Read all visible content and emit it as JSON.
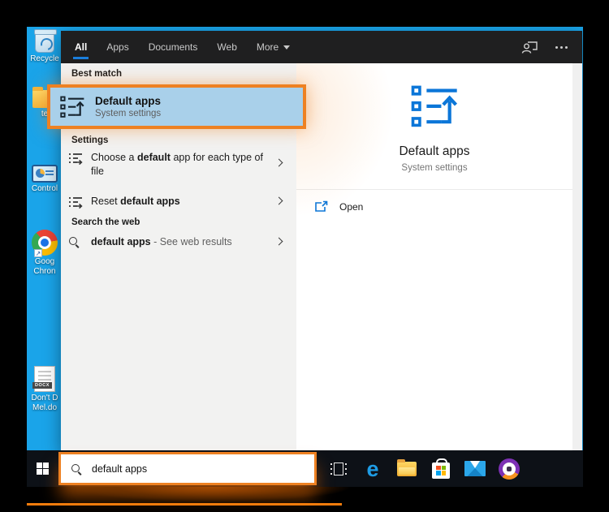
{
  "theme": {
    "highlight_orange": "#EE8122",
    "selection_blue": "#A9D0EA",
    "accent_blue": "#0B76D8",
    "desktop_blue": "#1AA4E9",
    "taskbar_dark": "#0D1117",
    "header_dark": "#1F1F20"
  },
  "desktop": {
    "icons": [
      {
        "name": "recycle-bin",
        "label": "Recycle"
      },
      {
        "name": "folder",
        "label": "te"
      },
      {
        "name": "control-panel",
        "label": "Control"
      },
      {
        "name": "google-chrome",
        "label_lines": [
          "Goog",
          "Chron"
        ]
      },
      {
        "name": "docx-document",
        "label_lines": [
          "Don't D",
          "Mel.do"
        ],
        "badge": "DOCX"
      }
    ]
  },
  "search_flyout": {
    "tabs": [
      {
        "label": "All",
        "active": true
      },
      {
        "label": "Apps"
      },
      {
        "label": "Documents"
      },
      {
        "label": "Web"
      },
      {
        "label": "More",
        "has_dropdown": true
      }
    ],
    "best_match": {
      "section_label": "Best match",
      "title": "Default apps",
      "subtitle": "System settings"
    },
    "settings": {
      "section_label": "Settings",
      "items": [
        {
          "prefix": "Choose a ",
          "bold": "default",
          "suffix": " app for each type of file"
        },
        {
          "prefix": "Reset ",
          "bold": "default apps",
          "suffix": ""
        }
      ]
    },
    "web": {
      "section_label": "Search the web",
      "item": {
        "bold": "default apps",
        "suffix": " - See web results"
      }
    },
    "preview": {
      "title": "Default apps",
      "subtitle": "System settings",
      "open_label": "Open"
    }
  },
  "taskbar": {
    "search_value": "default apps"
  }
}
